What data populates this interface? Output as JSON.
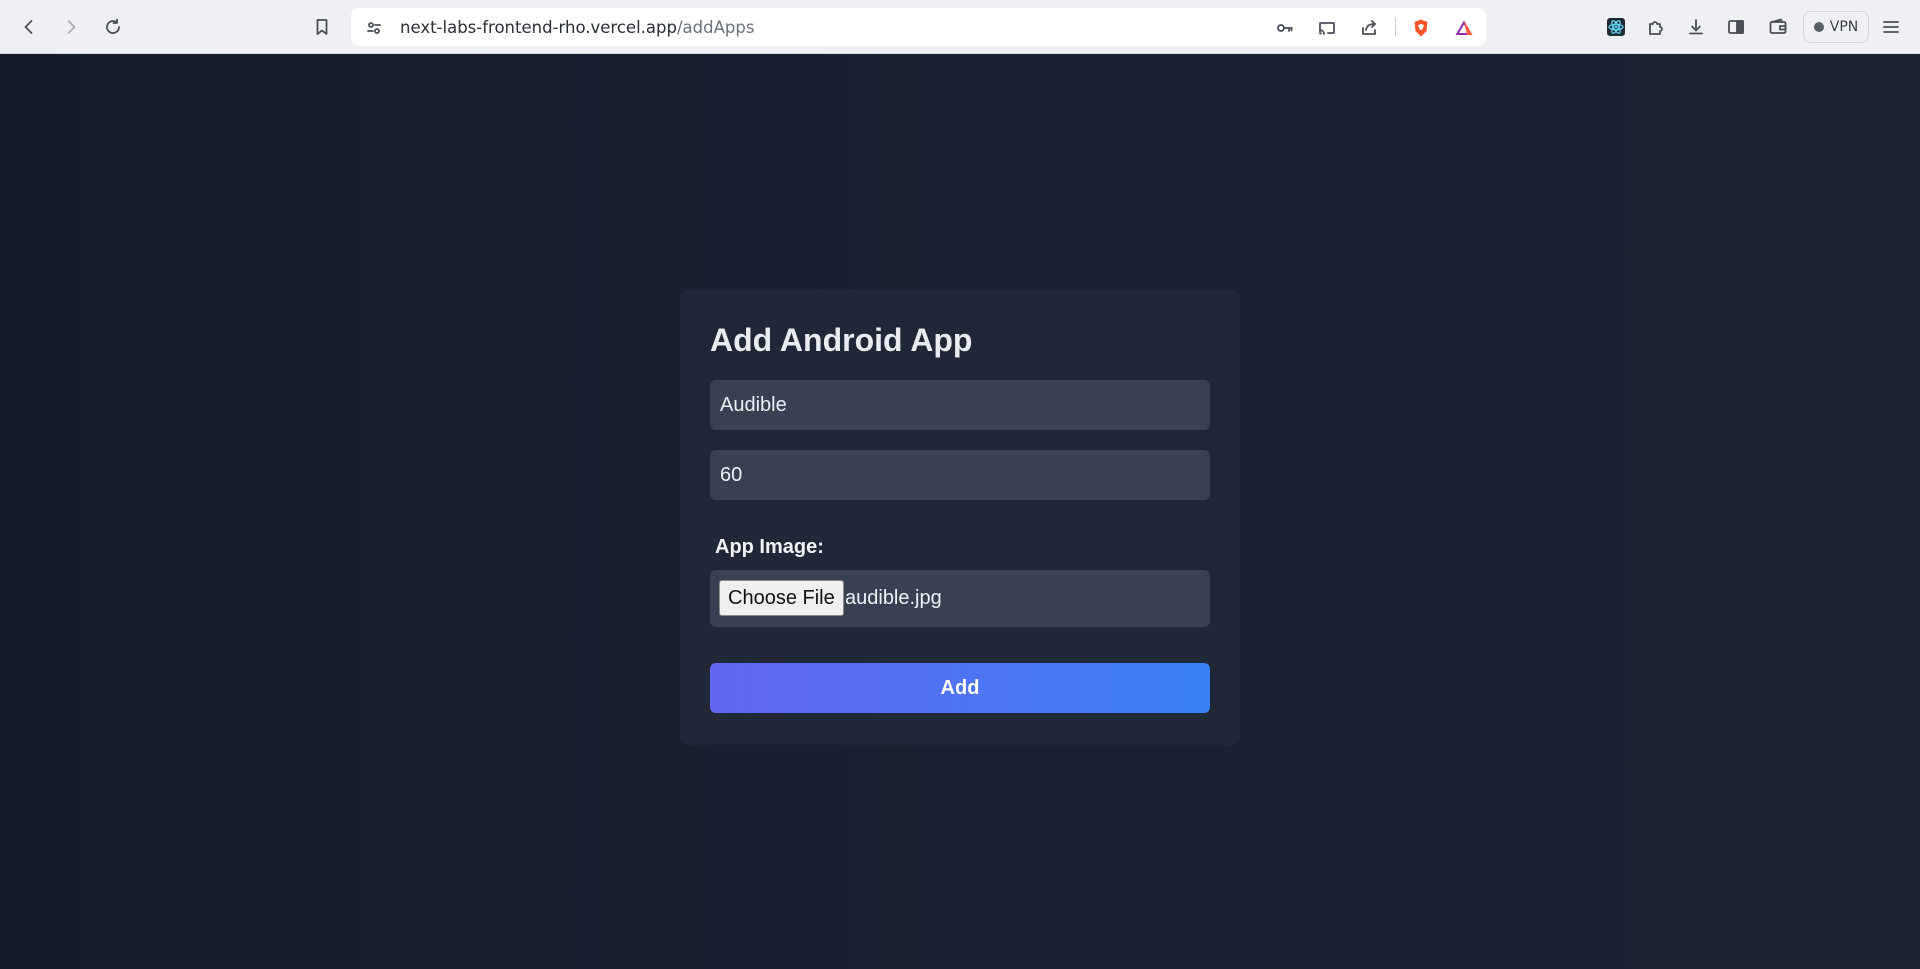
{
  "browser": {
    "url_host": "next-labs-frontend-rho.vercel.app",
    "url_path": "/addApps",
    "vpn_label": "VPN",
    "icons": [
      "back-icon",
      "forward-icon",
      "reload-icon",
      "bookmark-icon",
      "site-settings-icon",
      "key-icon",
      "cast-icon",
      "share-icon",
      "brave-shields-icon",
      "brave-rewards-icon",
      "react-devtools-icon",
      "extensions-icon",
      "download-icon",
      "sidebar-icon",
      "wallet-icon",
      "menu-icon"
    ]
  },
  "form": {
    "title": "Add Android App",
    "name_value": "Audible",
    "points_value": "60",
    "image_label": "App Image:",
    "choose_file_label": "Choose File",
    "file_name": "audible.jpg",
    "submit_label": "Add"
  },
  "colors": {
    "page_bg": "#161d2a",
    "card_bg": "#202838",
    "input_bg": "#384152",
    "button_gradient_start": "#6366f1",
    "button_gradient_end": "#3b82f6"
  }
}
